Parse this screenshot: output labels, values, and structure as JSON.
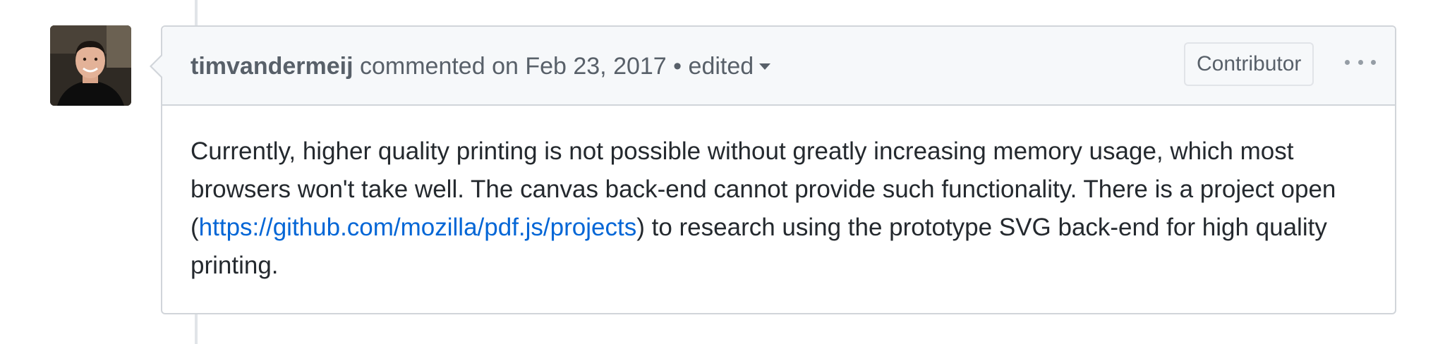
{
  "comment": {
    "author": "timvandermeij",
    "action_text": "commented on Feb 23, 2017",
    "separator": "•",
    "edited_label": "edited",
    "role_badge": "Contributor",
    "body": {
      "before_link": "Currently, higher quality printing is not possible without greatly increasing memory usage, which most browsers won't take well. The canvas back-end cannot provide such functionality. There is a project open (",
      "link_text": "https://github.com/mozilla/pdf.js/projects",
      "after_link": ") to research using the prototype SVG back-end for high quality printing."
    }
  },
  "icons": {
    "more": "kebab-horizontal-icon",
    "edited_dropdown": "triangle-down-icon"
  },
  "colors": {
    "header_bg": "#f6f8fa",
    "border": "#d1d5da",
    "link": "#0366d6",
    "muted_text": "#586069",
    "body_text": "#24292e"
  }
}
